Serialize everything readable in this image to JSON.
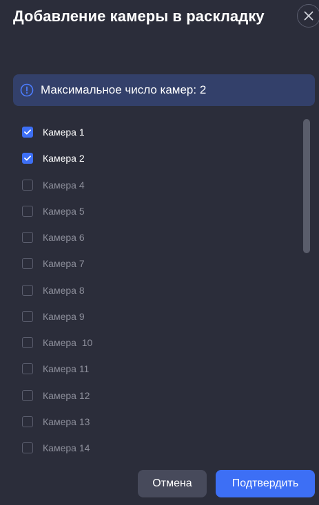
{
  "dialog": {
    "title": "Добавление камеры в раскладку",
    "close_icon": "close-icon"
  },
  "info": {
    "icon": "info-icon",
    "text": "Максимальное число камер: 2",
    "accent": "#3d6ff5"
  },
  "cameras": [
    {
      "label": "Камера 1",
      "checked": true
    },
    {
      "label": "Камера 2",
      "checked": true
    },
    {
      "label": "Камера 4",
      "checked": false
    },
    {
      "label": "Камера 5",
      "checked": false
    },
    {
      "label": "Камера 6",
      "checked": false
    },
    {
      "label": "Камера 7",
      "checked": false
    },
    {
      "label": "Камера 8",
      "checked": false
    },
    {
      "label": "Камера 9",
      "checked": false
    },
    {
      "label": "Камера  10",
      "checked": false
    },
    {
      "label": "Камера 11",
      "checked": false
    },
    {
      "label": "Камера 12",
      "checked": false
    },
    {
      "label": "Камера 13",
      "checked": false
    },
    {
      "label": "Камера 14",
      "checked": false
    }
  ],
  "footer": {
    "cancel_label": "Отмена",
    "confirm_label": "Подтвердить"
  },
  "colors": {
    "background": "#2b2d3a",
    "banner": "#33406a",
    "primary": "#3d6ff5",
    "secondary_button": "#474a5b"
  }
}
